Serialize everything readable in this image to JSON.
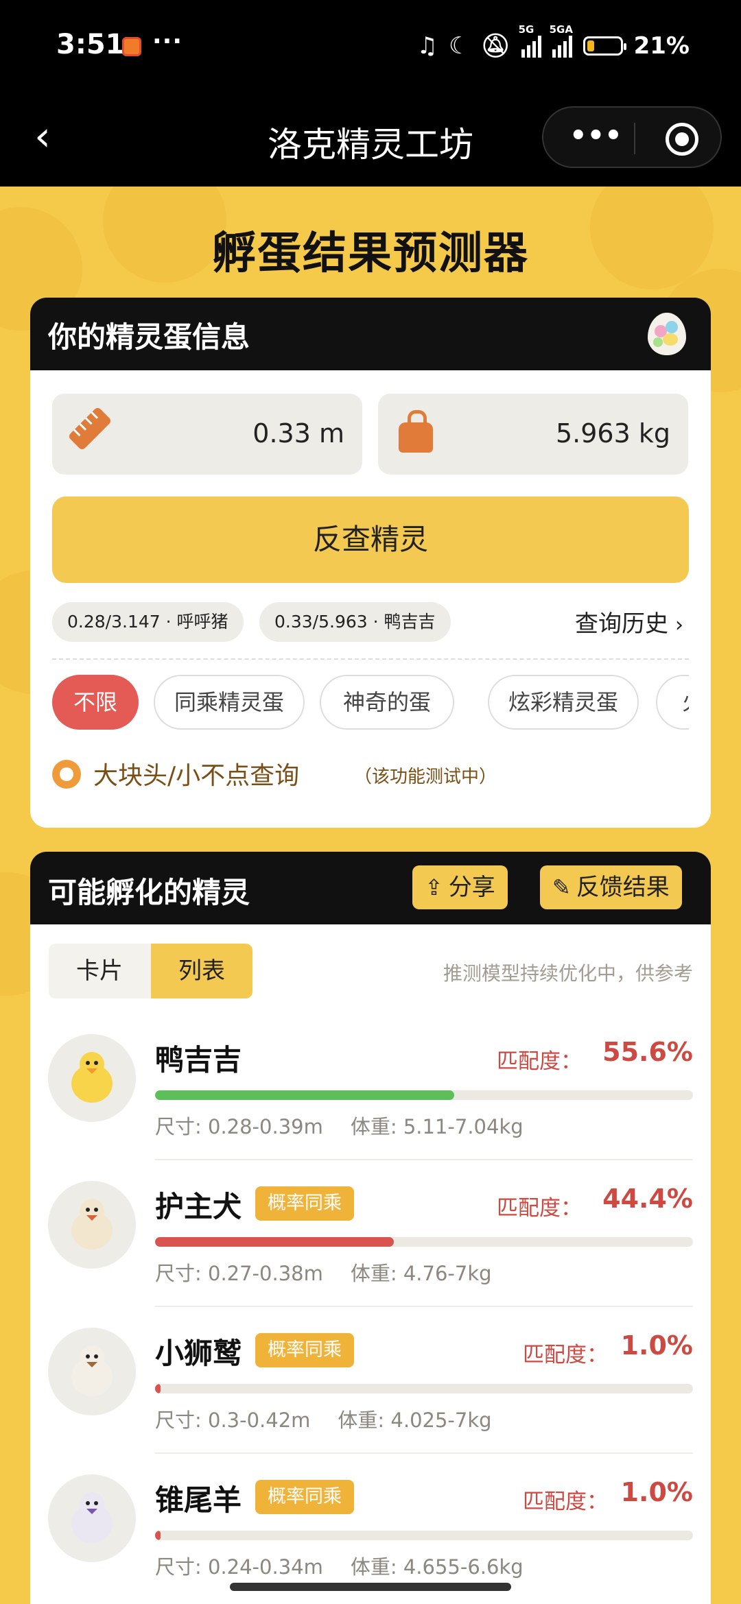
{
  "status_bar": {
    "time": "3:51",
    "dots": "···",
    "battery": "21%",
    "net1": "5G",
    "net2": "5GA"
  },
  "nav": {
    "back": "‹",
    "title": "洛克精灵工坊",
    "more": "•••"
  },
  "page_title": "孵蛋结果预测器",
  "egg_card": {
    "title": "你的精灵蛋信息",
    "height_value": "0.33  m",
    "weight_value": "5.963  kg",
    "query_button": "反查精灵",
    "history": [
      {
        "label": "0.28/3.147 · 呼呼猪"
      },
      {
        "label": "0.33/5.963 · 鸭吉吉"
      }
    ],
    "history_link": "查询历史",
    "history_chevron": "›",
    "filters": [
      {
        "label": "不限",
        "active": true
      },
      {
        "label": "同乘精灵蛋",
        "active": false
      },
      {
        "label": "神奇的蛋",
        "active": false
      },
      {
        "label": "炫彩精灵蛋",
        "active": false
      },
      {
        "label": "火焰",
        "active": false
      }
    ],
    "option_label": "大块头/小不点查询",
    "option_note": "（该功能测试中）"
  },
  "result_card": {
    "title": "可能孵化的精灵",
    "share_button": "分享",
    "feedback_button": "反馈结果",
    "view_tabs": [
      {
        "label": "卡片"
      },
      {
        "label": "列表"
      }
    ],
    "active_view": "列表",
    "note": "推测模型持续优化中，供参考",
    "match_label": "匹配度：",
    "items": [
      {
        "name": "鸭吉吉",
        "tag": "",
        "match": "55.6%",
        "match_fraction": 0.556,
        "bar_color": "#5cbf5a",
        "size": "尺寸: 0.28-0.39m",
        "weight": "体重: 5.11-7.04kg"
      },
      {
        "name": "护主犬",
        "tag": "概率同乘",
        "match": "44.4%",
        "match_fraction": 0.444,
        "bar_color": "#d9534f",
        "size": "尺寸: 0.27-0.38m",
        "weight": "体重: 4.76-7kg"
      },
      {
        "name": "小狮鹫",
        "tag": "概率同乘",
        "match": "1.0%",
        "match_fraction": 0.01,
        "bar_color": "#d9534f",
        "size": "尺寸: 0.3-0.42m",
        "weight": "体重: 4.025-7kg"
      },
      {
        "name": "锥尾羊",
        "tag": "概率同乘",
        "match": "1.0%",
        "match_fraction": 0.01,
        "bar_color": "#d9534f",
        "size": "尺寸: 0.24-0.34m",
        "weight": "体重: 4.655-6.6kg"
      }
    ]
  },
  "colors": {
    "accent_yellow": "#f3c951",
    "header_black": "#111111",
    "match_red": "#cc4a42",
    "filter_active": "#e45a54"
  }
}
